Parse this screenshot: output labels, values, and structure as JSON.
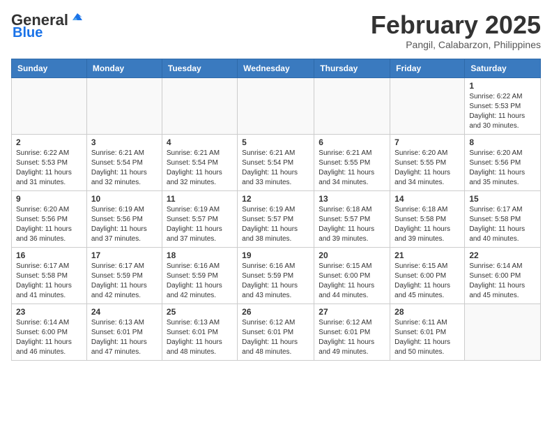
{
  "header": {
    "logo_general": "General",
    "logo_blue": "Blue",
    "month_title": "February 2025",
    "location": "Pangil, Calabarzon, Philippines"
  },
  "days_of_week": [
    "Sunday",
    "Monday",
    "Tuesday",
    "Wednesday",
    "Thursday",
    "Friday",
    "Saturday"
  ],
  "weeks": [
    [
      {
        "day": "",
        "info": ""
      },
      {
        "day": "",
        "info": ""
      },
      {
        "day": "",
        "info": ""
      },
      {
        "day": "",
        "info": ""
      },
      {
        "day": "",
        "info": ""
      },
      {
        "day": "",
        "info": ""
      },
      {
        "day": "1",
        "info": "Sunrise: 6:22 AM\nSunset: 5:53 PM\nDaylight: 11 hours\nand 30 minutes."
      }
    ],
    [
      {
        "day": "2",
        "info": "Sunrise: 6:22 AM\nSunset: 5:53 PM\nDaylight: 11 hours\nand 31 minutes."
      },
      {
        "day": "3",
        "info": "Sunrise: 6:21 AM\nSunset: 5:54 PM\nDaylight: 11 hours\nand 32 minutes."
      },
      {
        "day": "4",
        "info": "Sunrise: 6:21 AM\nSunset: 5:54 PM\nDaylight: 11 hours\nand 32 minutes."
      },
      {
        "day": "5",
        "info": "Sunrise: 6:21 AM\nSunset: 5:54 PM\nDaylight: 11 hours\nand 33 minutes."
      },
      {
        "day": "6",
        "info": "Sunrise: 6:21 AM\nSunset: 5:55 PM\nDaylight: 11 hours\nand 34 minutes."
      },
      {
        "day": "7",
        "info": "Sunrise: 6:20 AM\nSunset: 5:55 PM\nDaylight: 11 hours\nand 34 minutes."
      },
      {
        "day": "8",
        "info": "Sunrise: 6:20 AM\nSunset: 5:56 PM\nDaylight: 11 hours\nand 35 minutes."
      }
    ],
    [
      {
        "day": "9",
        "info": "Sunrise: 6:20 AM\nSunset: 5:56 PM\nDaylight: 11 hours\nand 36 minutes."
      },
      {
        "day": "10",
        "info": "Sunrise: 6:19 AM\nSunset: 5:56 PM\nDaylight: 11 hours\nand 37 minutes."
      },
      {
        "day": "11",
        "info": "Sunrise: 6:19 AM\nSunset: 5:57 PM\nDaylight: 11 hours\nand 37 minutes."
      },
      {
        "day": "12",
        "info": "Sunrise: 6:19 AM\nSunset: 5:57 PM\nDaylight: 11 hours\nand 38 minutes."
      },
      {
        "day": "13",
        "info": "Sunrise: 6:18 AM\nSunset: 5:57 PM\nDaylight: 11 hours\nand 39 minutes."
      },
      {
        "day": "14",
        "info": "Sunrise: 6:18 AM\nSunset: 5:58 PM\nDaylight: 11 hours\nand 39 minutes."
      },
      {
        "day": "15",
        "info": "Sunrise: 6:17 AM\nSunset: 5:58 PM\nDaylight: 11 hours\nand 40 minutes."
      }
    ],
    [
      {
        "day": "16",
        "info": "Sunrise: 6:17 AM\nSunset: 5:58 PM\nDaylight: 11 hours\nand 41 minutes."
      },
      {
        "day": "17",
        "info": "Sunrise: 6:17 AM\nSunset: 5:59 PM\nDaylight: 11 hours\nand 42 minutes."
      },
      {
        "day": "18",
        "info": "Sunrise: 6:16 AM\nSunset: 5:59 PM\nDaylight: 11 hours\nand 42 minutes."
      },
      {
        "day": "19",
        "info": "Sunrise: 6:16 AM\nSunset: 5:59 PM\nDaylight: 11 hours\nand 43 minutes."
      },
      {
        "day": "20",
        "info": "Sunrise: 6:15 AM\nSunset: 6:00 PM\nDaylight: 11 hours\nand 44 minutes."
      },
      {
        "day": "21",
        "info": "Sunrise: 6:15 AM\nSunset: 6:00 PM\nDaylight: 11 hours\nand 45 minutes."
      },
      {
        "day": "22",
        "info": "Sunrise: 6:14 AM\nSunset: 6:00 PM\nDaylight: 11 hours\nand 45 minutes."
      }
    ],
    [
      {
        "day": "23",
        "info": "Sunrise: 6:14 AM\nSunset: 6:00 PM\nDaylight: 11 hours\nand 46 minutes."
      },
      {
        "day": "24",
        "info": "Sunrise: 6:13 AM\nSunset: 6:01 PM\nDaylight: 11 hours\nand 47 minutes."
      },
      {
        "day": "25",
        "info": "Sunrise: 6:13 AM\nSunset: 6:01 PM\nDaylight: 11 hours\nand 48 minutes."
      },
      {
        "day": "26",
        "info": "Sunrise: 6:12 AM\nSunset: 6:01 PM\nDaylight: 11 hours\nand 48 minutes."
      },
      {
        "day": "27",
        "info": "Sunrise: 6:12 AM\nSunset: 6:01 PM\nDaylight: 11 hours\nand 49 minutes."
      },
      {
        "day": "28",
        "info": "Sunrise: 6:11 AM\nSunset: 6:01 PM\nDaylight: 11 hours\nand 50 minutes."
      },
      {
        "day": "",
        "info": ""
      }
    ]
  ]
}
